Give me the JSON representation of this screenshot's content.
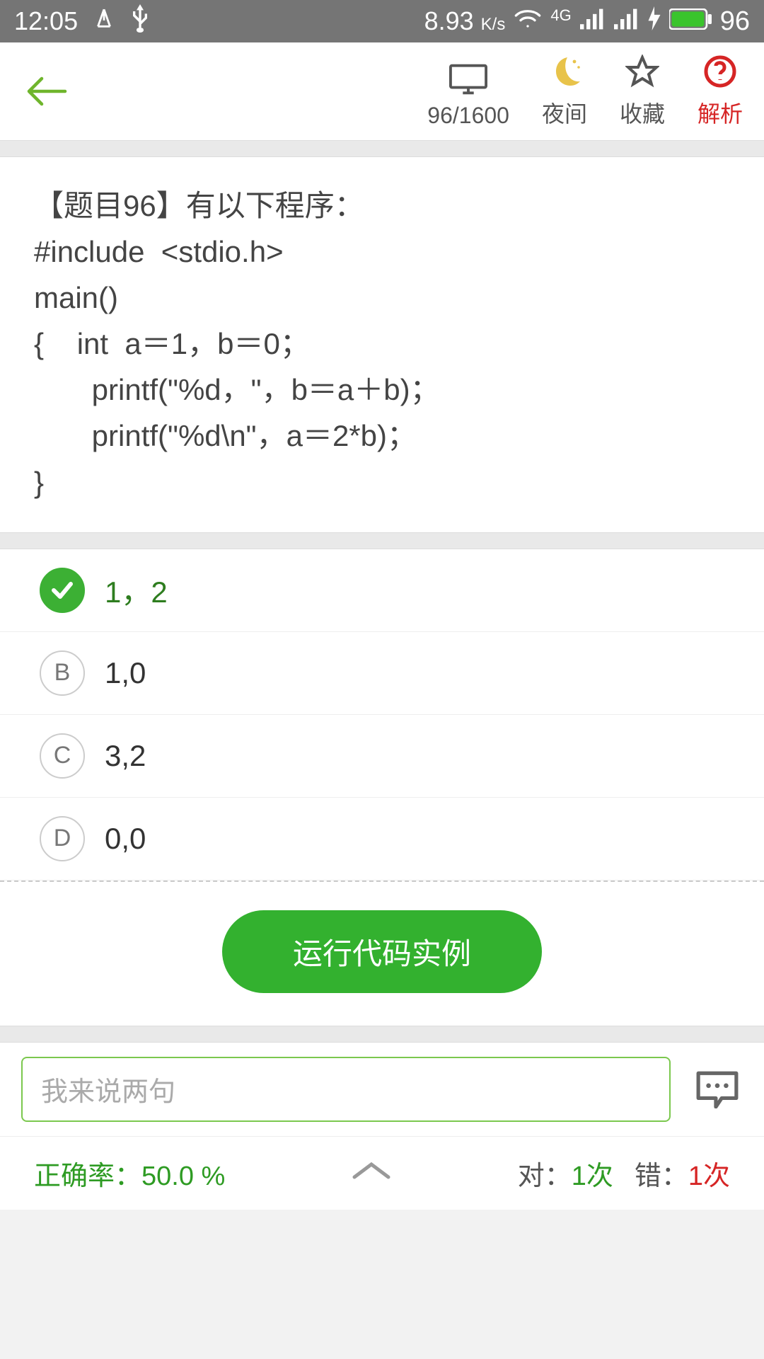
{
  "status": {
    "time": "12:05",
    "speed": "8.93",
    "speed_unit": "K/s",
    "battery": "96"
  },
  "header": {
    "counter": "96/1600",
    "night": "夜间",
    "favorite": "收藏",
    "analysis": "解析"
  },
  "question": {
    "l1": "【题目96】有以下程序：",
    "l2": "#include  <stdio.h>",
    "l3": "main()",
    "l4": "{    int  a＝1，b＝0；",
    "l5": "       printf(\"%d，\"，b＝a＋b)；",
    "l6": "       printf(\"%d\\n\"，a＝2*b)；",
    "l7": "}"
  },
  "options": {
    "a": "1，2",
    "b_letter": "B",
    "b": "1,0",
    "c_letter": "C",
    "c": "3,2",
    "d_letter": "D",
    "d": "0,0"
  },
  "actions": {
    "run": "运行代码实例",
    "comment_placeholder": "我来说两句"
  },
  "stats": {
    "accuracy_label": "正确率：",
    "accuracy_value": "50.0 %",
    "correct_label": "对：",
    "correct_value": "1次",
    "wrong_label": "错：",
    "wrong_value": "1次"
  }
}
